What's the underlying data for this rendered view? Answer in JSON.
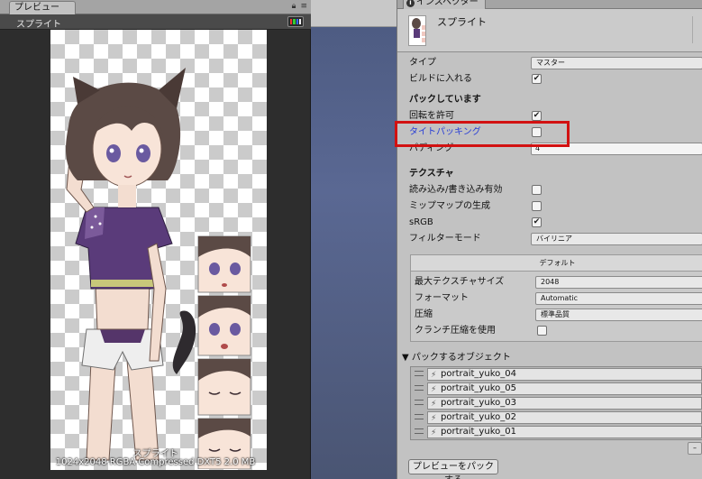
{
  "preview": {
    "tab_label": "プレビュー",
    "title": "スプライト",
    "caption_name": "スプライト",
    "caption_info": "1024x2048 RGBA Compressed DXT5  2.0 MB",
    "tab_icons": [
      "lock-icon",
      "menu-icon"
    ]
  },
  "inspector": {
    "tab_label": "インスペクター",
    "title": "スプライト",
    "type_label": "タイプ",
    "type_value": "マスター",
    "build_label": "ビルドに入れる",
    "build_checked": true,
    "packing_section": "パックしています",
    "rotation_label": "回転を許可",
    "rotation_checked": true,
    "tight_label": "タイトパッキング",
    "tight_checked": false,
    "padding_label": "パディング",
    "padding_value": "4",
    "texture_section": "テクスチャ",
    "readwrite_label": "読み込み/書き込み有効",
    "readwrite_checked": false,
    "mipmap_label": "ミップマップの生成",
    "mipmap_checked": false,
    "srgb_label": "sRGB",
    "srgb_checked": true,
    "filter_label": "フィルターモード",
    "filter_value": "バイリニア",
    "platform_tab": "デフォルト",
    "maxsize_label": "最大テクスチャサイズ",
    "maxsize_value": "2048",
    "format_label": "フォーマット",
    "format_value": "Automatic",
    "compression_label": "圧縮",
    "compression_value": "標準品質",
    "crunch_label": "クランチ圧縮を使用",
    "crunch_checked": false,
    "pack_header": "パックするオブジェクト",
    "pack_items": [
      "portrait_yuko_04",
      "portrait_yuko_05",
      "portrait_yuko_03",
      "portrait_yuko_02",
      "portrait_yuko_01"
    ],
    "pack_button": "プレビューをパックする",
    "highlight_color": "#d21111",
    "link_color": "#2a3fd6"
  }
}
